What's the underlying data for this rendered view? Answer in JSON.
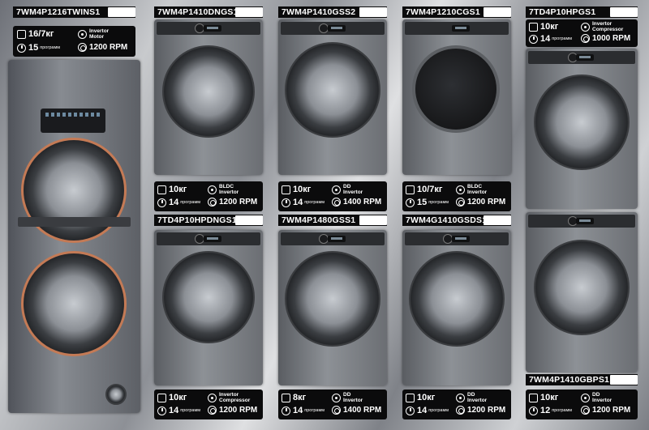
{
  "products": [
    {
      "model": "7WM4P1216TWINS1",
      "capacity": "16/7кг",
      "programs_num": "15",
      "programs_word": "программ",
      "motor_line1": "Invertor",
      "motor_line2": "Motor",
      "rpm": "1200 RPM"
    },
    {
      "model": "7WM4P1410DNGS1",
      "capacity": "10кг",
      "programs_num": "14",
      "programs_word": "программ",
      "motor_line1": "BLDC",
      "motor_line2": "Invertor",
      "rpm": "1200 RPM"
    },
    {
      "model": "7WM4P1410GSS2",
      "capacity": "10кг",
      "programs_num": "14",
      "programs_word": "программ",
      "motor_line1": "DD",
      "motor_line2": "Invertor",
      "rpm": "1400 RPM"
    },
    {
      "model": "7WM4P1210CGS1",
      "capacity": "10/7кг",
      "programs_num": "15",
      "programs_word": "программ",
      "motor_line1": "BLDC",
      "motor_line2": "Invertor",
      "rpm": "1200 RPM"
    },
    {
      "model": "7TD4P10HPGS1",
      "capacity": "10кг",
      "programs_num": "14",
      "programs_word": "программ",
      "motor_line1": "Invertor",
      "motor_line2": "Compressor",
      "rpm": "1000 RPM"
    },
    {
      "model": "7TD4P10HPDNGS1",
      "capacity": "10кг",
      "programs_num": "14",
      "programs_word": "программ",
      "motor_line1": "Invertor",
      "motor_line2": "Compressor",
      "rpm": "1200 RPM"
    },
    {
      "model": "7WM4P1480GSS1",
      "capacity": "8кг",
      "programs_num": "14",
      "programs_word": "программ",
      "motor_line1": "DD",
      "motor_line2": "Invertor",
      "rpm": "1400 RPM"
    },
    {
      "model": "7WM4G1410GSDS1",
      "capacity": "10кг",
      "programs_num": "14",
      "programs_word": "программ",
      "motor_line1": "DD",
      "motor_line2": "Invertor",
      "rpm": "1200 RPM"
    },
    {
      "model": "7WM4P1410GBPS1",
      "capacity": "10кг",
      "programs_num": "12",
      "programs_word": "программ",
      "motor_line1": "DD",
      "motor_line2": "Invertor",
      "rpm": "1200 RPM"
    }
  ],
  "icons": {
    "capacity": "washing-machine-icon",
    "programs": "program-dial-icon",
    "motor": "inverter-snowflake-icon",
    "rpm": "spin-drum-icon"
  }
}
